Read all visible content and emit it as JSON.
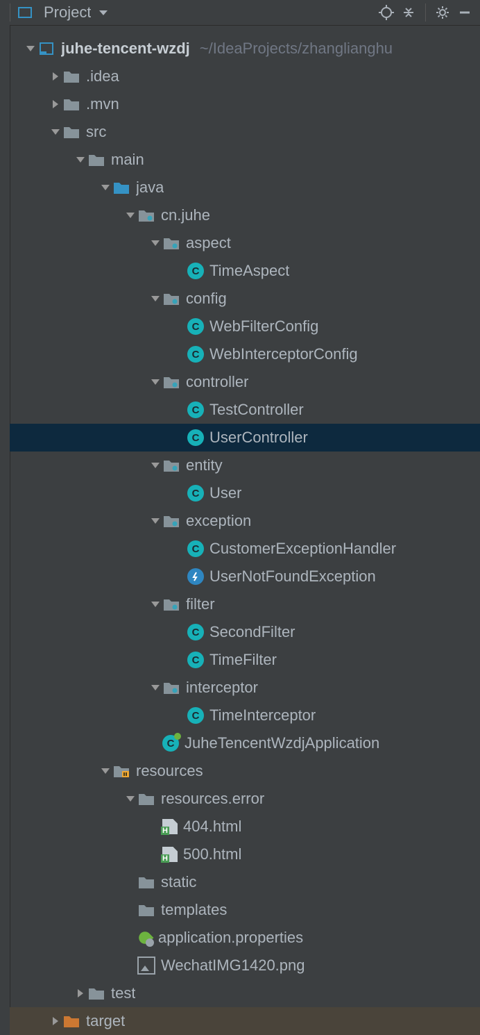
{
  "toolbar": {
    "title": "Project"
  },
  "project": {
    "name": "juhe-tencent-wzdj",
    "path": "~/IdeaProjects/zhanglianghu"
  },
  "tree": [
    {
      "depth": 0,
      "arrow": "down",
      "icon": "module",
      "label": "juhe-tencent-wzdj",
      "bold": true,
      "path": "~/IdeaProjects/zhanglianghu",
      "name": "project-root"
    },
    {
      "depth": 1,
      "arrow": "right",
      "icon": "folder-gray",
      "label": ".idea",
      "name": "folder-idea"
    },
    {
      "depth": 1,
      "arrow": "right",
      "icon": "folder-gray",
      "label": ".mvn",
      "name": "folder-mvn"
    },
    {
      "depth": 1,
      "arrow": "down",
      "icon": "folder-gray",
      "label": "src",
      "name": "folder-src"
    },
    {
      "depth": 2,
      "arrow": "down",
      "icon": "folder-gray",
      "label": "main",
      "name": "folder-main"
    },
    {
      "depth": 3,
      "arrow": "down",
      "icon": "folder-blue",
      "label": "java",
      "name": "folder-java"
    },
    {
      "depth": 4,
      "arrow": "down",
      "icon": "package",
      "label": "cn.juhe",
      "name": "package-cnjuhe"
    },
    {
      "depth": 5,
      "arrow": "down",
      "icon": "package",
      "label": "aspect",
      "name": "package-aspect"
    },
    {
      "depth": 6,
      "arrow": "none",
      "icon": "class",
      "label": "TimeAspect",
      "name": "class-timeaspect"
    },
    {
      "depth": 5,
      "arrow": "down",
      "icon": "package",
      "label": "config",
      "name": "package-config"
    },
    {
      "depth": 6,
      "arrow": "none",
      "icon": "class",
      "label": "WebFilterConfig",
      "name": "class-webfilterconfig"
    },
    {
      "depth": 6,
      "arrow": "none",
      "icon": "class",
      "label": "WebInterceptorConfig",
      "name": "class-webinterceptorconfig"
    },
    {
      "depth": 5,
      "arrow": "down",
      "icon": "package",
      "label": "controller",
      "name": "package-controller"
    },
    {
      "depth": 6,
      "arrow": "none",
      "icon": "class",
      "label": "TestController",
      "name": "class-testcontroller"
    },
    {
      "depth": 6,
      "arrow": "none",
      "icon": "class",
      "label": "UserController",
      "selected": true,
      "name": "class-usercontroller"
    },
    {
      "depth": 5,
      "arrow": "down",
      "icon": "package",
      "label": "entity",
      "name": "package-entity"
    },
    {
      "depth": 6,
      "arrow": "none",
      "icon": "class",
      "label": "User",
      "name": "class-user"
    },
    {
      "depth": 5,
      "arrow": "down",
      "icon": "package",
      "label": "exception",
      "name": "package-exception"
    },
    {
      "depth": 6,
      "arrow": "none",
      "icon": "class",
      "label": "CustomerExceptionHandler",
      "name": "class-customerexceptionhandler"
    },
    {
      "depth": 6,
      "arrow": "none",
      "icon": "exception",
      "label": "UserNotFoundException",
      "name": "class-usernotfoundexception"
    },
    {
      "depth": 5,
      "arrow": "down",
      "icon": "package",
      "label": "filter",
      "name": "package-filter"
    },
    {
      "depth": 6,
      "arrow": "none",
      "icon": "class",
      "label": "SecondFilter",
      "name": "class-secondfilter"
    },
    {
      "depth": 6,
      "arrow": "none",
      "icon": "class",
      "label": "TimeFilter",
      "name": "class-timefilter"
    },
    {
      "depth": 5,
      "arrow": "down",
      "icon": "package",
      "label": "interceptor",
      "name": "package-interceptor"
    },
    {
      "depth": 6,
      "arrow": "none",
      "icon": "class",
      "label": "TimeInterceptor",
      "name": "class-timeinterceptor"
    },
    {
      "depth": 5,
      "arrow": "none",
      "icon": "spring",
      "label": "JuheTencentWzdjApplication",
      "name": "class-application"
    },
    {
      "depth": 3,
      "arrow": "down",
      "icon": "resources",
      "label": "resources",
      "name": "folder-resources"
    },
    {
      "depth": 4,
      "arrow": "down",
      "icon": "folder-gray",
      "label": "resources.error",
      "name": "folder-resources-error"
    },
    {
      "depth": 5,
      "arrow": "none",
      "icon": "html",
      "label": "404.html",
      "name": "file-404"
    },
    {
      "depth": 5,
      "arrow": "none",
      "icon": "html",
      "label": "500.html",
      "name": "file-500"
    },
    {
      "depth": 4,
      "arrow": "none",
      "icon": "folder-gray",
      "label": "static",
      "name": "folder-static"
    },
    {
      "depth": 4,
      "arrow": "none",
      "icon": "folder-gray",
      "label": "templates",
      "name": "folder-templates"
    },
    {
      "depth": 4,
      "arrow": "none",
      "icon": "properties",
      "label": "application.properties",
      "name": "file-properties"
    },
    {
      "depth": 4,
      "arrow": "none",
      "icon": "image",
      "label": "WechatIMG1420.png",
      "name": "file-image"
    },
    {
      "depth": 2,
      "arrow": "right",
      "icon": "folder-gray",
      "label": "test",
      "name": "folder-test"
    },
    {
      "depth": 1,
      "arrow": "right",
      "icon": "folder-orange",
      "label": "target",
      "targetrow": true,
      "name": "folder-target"
    }
  ]
}
